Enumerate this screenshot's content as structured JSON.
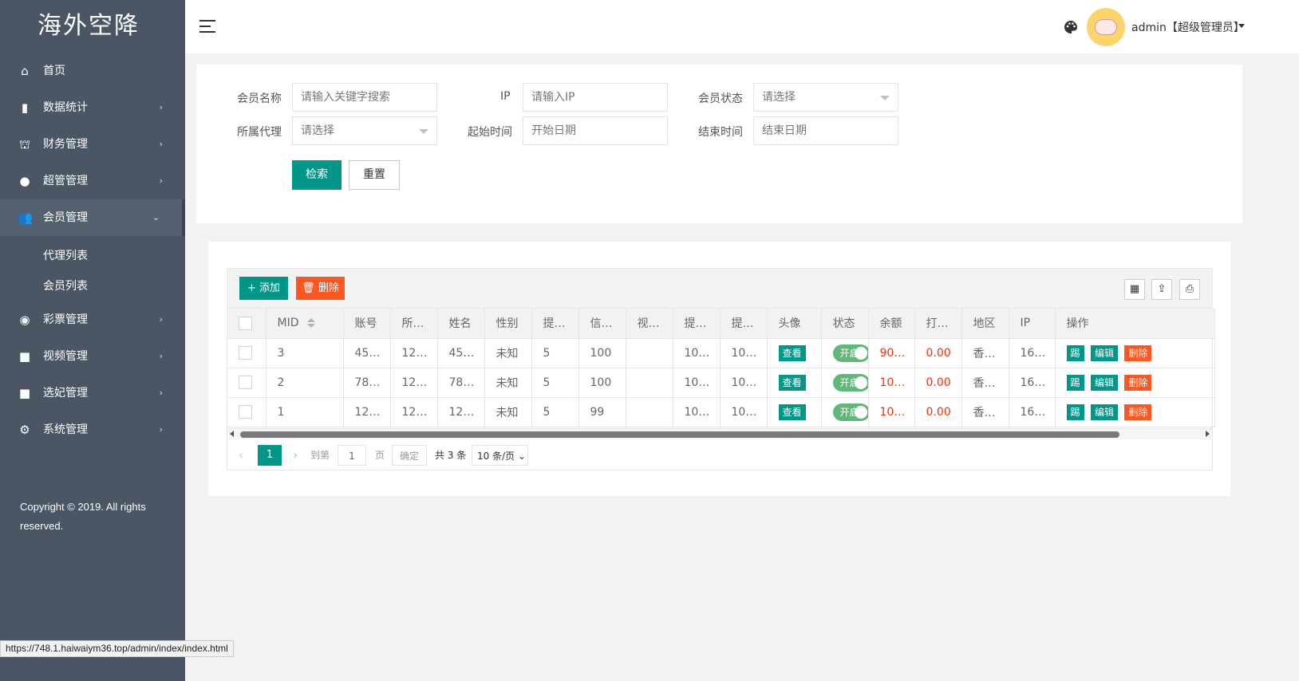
{
  "app": {
    "logo": "海外空降"
  },
  "sidebar": {
    "items": [
      {
        "label": "首页",
        "icon": "home-icon",
        "glyph": "⌂",
        "arrow": ""
      },
      {
        "label": "数据统计",
        "icon": "bar-chart-icon",
        "glyph": "▮",
        "arrow": "›"
      },
      {
        "label": "财务管理",
        "icon": "bank-icon",
        "glyph": "⛫",
        "arrow": "›"
      },
      {
        "label": "超管管理",
        "icon": "user-icon",
        "glyph": "●",
        "arrow": "›"
      },
      {
        "label": "会员管理",
        "icon": "users-icon",
        "glyph": "👥",
        "arrow": "⌄"
      },
      {
        "label": "彩票管理",
        "icon": "gamepad-icon",
        "glyph": "◉",
        "arrow": "›"
      },
      {
        "label": "视频管理",
        "icon": "video-icon",
        "glyph": "■",
        "arrow": "›"
      },
      {
        "label": "选妃管理",
        "icon": "camera-icon",
        "glyph": "■",
        "arrow": "›"
      },
      {
        "label": "系统管理",
        "icon": "gear-icon",
        "glyph": "⚙",
        "arrow": "›"
      }
    ],
    "subitems": [
      "代理列表",
      "会员列表"
    ],
    "copyright": "Copyright © 2019. All rights reserved."
  },
  "header": {
    "user": "admin【超级管理员】"
  },
  "search": {
    "member_name_label": "会员名称",
    "member_name_placeholder": "请输入关键字搜索",
    "ip_label": "IP",
    "ip_placeholder": "请输入IP",
    "status_label": "会员状态",
    "status_value": "请选择",
    "agent_label": "所属代理",
    "agent_value": "请选择",
    "start_label": "起始时间",
    "start_placeholder": "开始日期",
    "end_label": "结束时间",
    "end_placeholder": "结束日期",
    "search_button": "检索",
    "reset_button": "重置"
  },
  "table": {
    "add_button": "+ 添加",
    "delete_button": "删除",
    "headers": [
      "MID",
      "账号",
      "所…",
      "姓名",
      "性别",
      "提…",
      "信…",
      "视…",
      "提…",
      "提…",
      "头像",
      "状态",
      "余额",
      "打…",
      "地区",
      "IP",
      "操作"
    ],
    "rows": [
      {
        "mid": "3",
        "account": "45…",
        "agent": "12…",
        "name": "45…",
        "gender": "未知",
        "c5": "5",
        "credit": "100",
        "video": "",
        "c8": "10…",
        "c9": "10…",
        "avatar_btn": "查看",
        "status": "开启",
        "balance": "90…",
        "c13": "0.00",
        "region": "香…",
        "ip": "16…"
      },
      {
        "mid": "2",
        "account": "78…",
        "agent": "12…",
        "name": "78…",
        "gender": "未知",
        "c5": "5",
        "credit": "100",
        "video": "",
        "c8": "10…",
        "c9": "10…",
        "avatar_btn": "查看",
        "status": "开启",
        "balance": "10…",
        "c13": "0.00",
        "region": "香…",
        "ip": "16…"
      },
      {
        "mid": "1",
        "account": "12…",
        "agent": "12…",
        "name": "12…",
        "gender": "未知",
        "c5": "5",
        "credit": "99",
        "video": "",
        "c8": "10…",
        "c9": "10…",
        "avatar_btn": "查看",
        "status": "开启",
        "balance": "10…",
        "c13": "0.00",
        "region": "香…",
        "ip": "16…"
      }
    ],
    "actions": [
      "踢",
      "编辑",
      "删除"
    ]
  },
  "pager": {
    "current": "1",
    "goto_label": "到第",
    "goto_value": "1",
    "page_label": "页",
    "confirm": "确定",
    "total": "共 3 条",
    "page_size": "10 条/页"
  },
  "statusbar": {
    "url": "https://748.1.haiwaiym36.top/admin/index/index.html"
  },
  "colors": {
    "sidebar": "#4b5665",
    "teal": "#009688",
    "orange": "#ff5722",
    "switch_on": "#5fb878",
    "red_text": "#ff2d00"
  }
}
